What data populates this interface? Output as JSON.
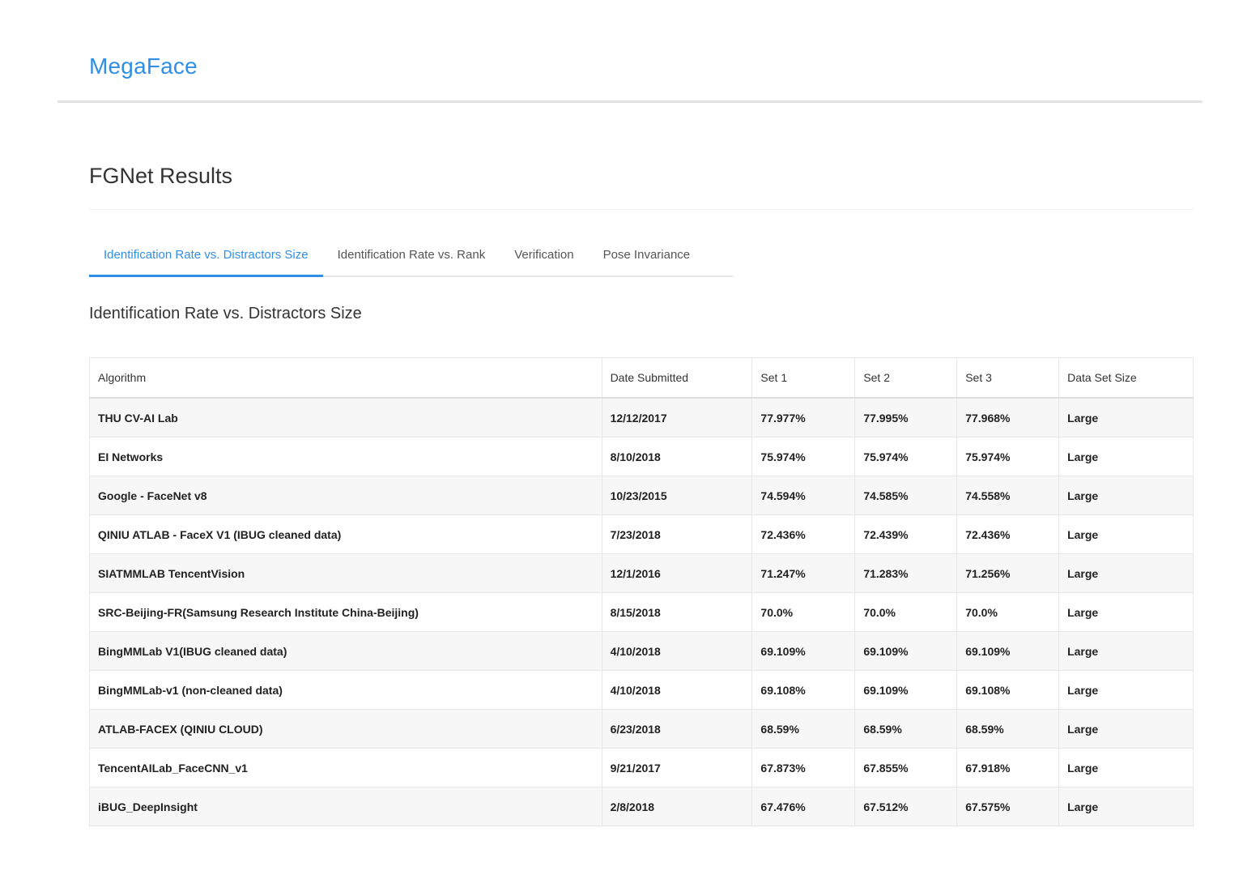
{
  "navbar": {
    "brand": "MegaFace"
  },
  "page": {
    "title": "FGNet Results"
  },
  "tabs": [
    {
      "label": "Identification Rate vs. Distractors Size",
      "active": true
    },
    {
      "label": "Identification Rate vs. Rank",
      "active": false
    },
    {
      "label": "Verification",
      "active": false
    },
    {
      "label": "Pose Invariance",
      "active": false
    }
  ],
  "section": {
    "title": "Identification Rate vs. Distractors Size"
  },
  "table": {
    "headers": [
      "Algorithm",
      "Date Submitted",
      "Set 1",
      "Set 2",
      "Set 3",
      "Data Set Size"
    ],
    "rows": [
      [
        "THU CV-AI Lab",
        "12/12/2017",
        "77.977%",
        "77.995%",
        "77.968%",
        "Large"
      ],
      [
        "EI Networks",
        "8/10/2018",
        "75.974%",
        "75.974%",
        "75.974%",
        "Large"
      ],
      [
        "Google - FaceNet v8",
        "10/23/2015",
        "74.594%",
        "74.585%",
        "74.558%",
        "Large"
      ],
      [
        "QINIU ATLAB - FaceX V1 (IBUG cleaned data)",
        "7/23/2018",
        "72.436%",
        "72.439%",
        "72.436%",
        "Large"
      ],
      [
        "SIATMMLAB TencentVision",
        "12/1/2016",
        "71.247%",
        "71.283%",
        "71.256%",
        "Large"
      ],
      [
        "SRC-Beijing-FR(Samsung Research Institute China-Beijing)",
        "8/15/2018",
        "70.0%",
        "70.0%",
        "70.0%",
        "Large"
      ],
      [
        "BingMMLab V1(IBUG cleaned data)",
        "4/10/2018",
        "69.109%",
        "69.109%",
        "69.109%",
        "Large"
      ],
      [
        "BingMMLab-v1 (non-cleaned data)",
        "4/10/2018",
        "69.108%",
        "69.109%",
        "69.108%",
        "Large"
      ],
      [
        "ATLAB-FACEX (QINIU CLOUD)",
        "6/23/2018",
        "68.59%",
        "68.59%",
        "68.59%",
        "Large"
      ],
      [
        "TencentAILab_FaceCNN_v1",
        "9/21/2017",
        "67.873%",
        "67.855%",
        "67.918%",
        "Large"
      ],
      [
        "iBUG_DeepInsight",
        "2/8/2018",
        "67.476%",
        "67.512%",
        "67.575%",
        "Large"
      ]
    ]
  },
  "colors": {
    "accent": "#2f8fe6",
    "stripe": "#f7f7f7",
    "border": "#e7e7e7"
  }
}
